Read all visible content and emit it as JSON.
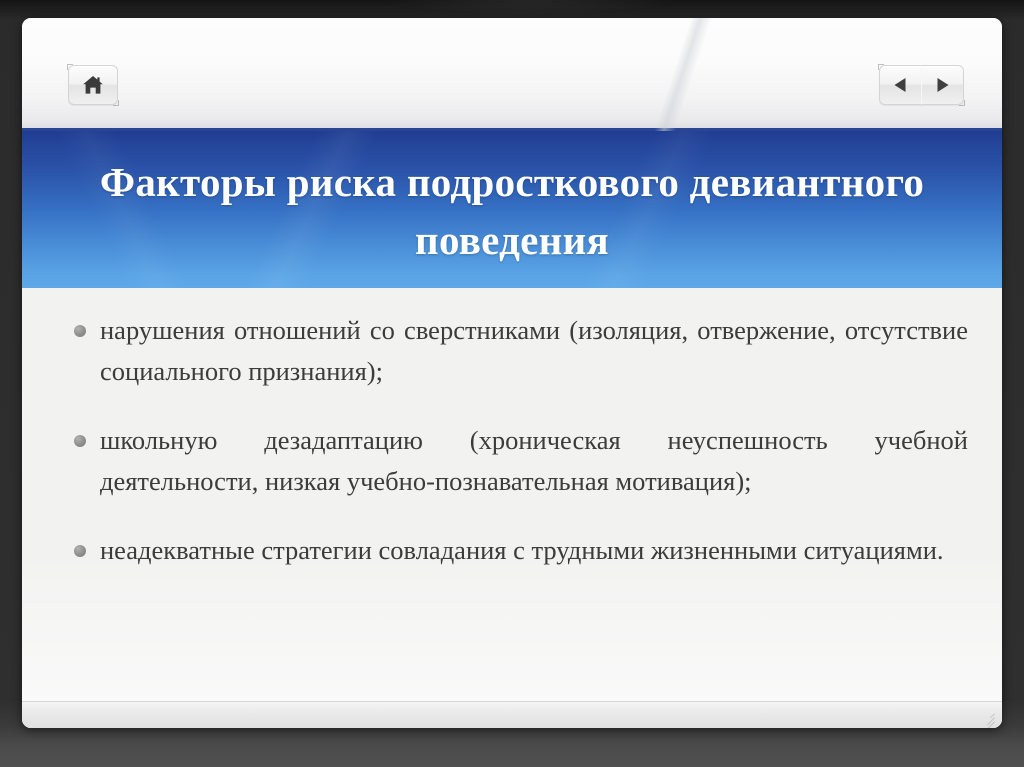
{
  "window": {
    "background_color": "#2b2b2b",
    "surface_color": "#ffffff"
  },
  "toolbar": {
    "home_button": {
      "icon": "home-icon",
      "label": ""
    },
    "previous_button": {
      "icon": "triangle-left-icon",
      "label": ""
    },
    "next_button": {
      "icon": "triangle-right-icon",
      "label": ""
    },
    "accent_color": "#2b4595"
  },
  "slide": {
    "title": "Факторы риска подросткового девиантного поведения",
    "title_color": "#ffffff",
    "banner_gradient_top": "#1f3c91",
    "banner_gradient_bottom": "#5ea8e8",
    "body_text_color": "#3c3c3c",
    "bullet_marker_color": "#8e8e8e",
    "bullets": [
      "нарушения отношений со сверстниками (изоляция, отвержение, отсутствие социального признания);",
      "школьную дезадаптацию (хроническая неуспешность учебной деятельности, низкая учебно-познавательная мотивация);",
      "неадекватные стратегии совладания с трудными жизненными ситуациями."
    ]
  },
  "status_bar": {
    "resize_grip_icon": "resize-grip-icon"
  }
}
